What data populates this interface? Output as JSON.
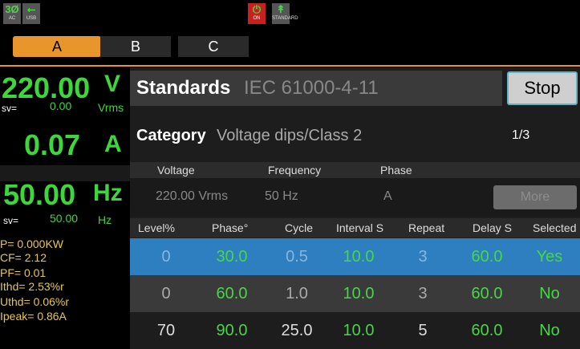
{
  "status_bar": {
    "phase_label": "3Ø",
    "ac_label": "AC",
    "usb_label": "USB",
    "on_label": "ON",
    "standard_label": "STANDARD"
  },
  "tabs": [
    "A",
    "B",
    "C"
  ],
  "meters": {
    "voltage": "220.00",
    "voltage_unit": "V",
    "voltage_sv_label": "sv=",
    "voltage_sv": "0.00",
    "voltage_sv_unit": "Vrms",
    "current": "0.07",
    "current_unit": "A",
    "frequency": "50.00",
    "frequency_unit": "Hz",
    "frequency_sv_label": "sv=",
    "frequency_sv": "50.00",
    "frequency_sv_unit": "Hz"
  },
  "info": [
    "P= 0.000KW",
    "CF= 2.12",
    "PF= 0.01",
    "Ithd= 2.53%r",
    "Uthd= 0.06%r",
    "Ipeak= 0.86A"
  ],
  "standards": {
    "label": "Standards",
    "value": "IEC 61000-4-11",
    "stop_label": "Stop",
    "category_label": "Category",
    "category_value": "Voltage dips/Class 2",
    "page": "1/3",
    "params_headers": [
      "Voltage",
      "Frequency",
      "Phase"
    ],
    "params_values": [
      "220.00 Vrms",
      "50 Hz",
      "A"
    ],
    "more_label": "More"
  },
  "table": {
    "headers": [
      "Level%",
      "Phase°",
      "Cycle",
      "Interval S",
      "Repeat",
      "Delay S",
      "Selected"
    ],
    "rows": [
      [
        "0",
        "30.0",
        "0.5",
        "10.0",
        "3",
        "60.0",
        "Yes"
      ],
      [
        "0",
        "60.0",
        "1.0",
        "10.0",
        "3",
        "60.0",
        "No"
      ],
      [
        "70",
        "90.0",
        "25.0",
        "10.0",
        "5",
        "60.0",
        "No"
      ]
    ]
  },
  "colors": {
    "accent": "#e8952c",
    "green": "#3dd63d",
    "selected_row": "#2d7fbf",
    "info_yellow": "#e8c84a"
  }
}
